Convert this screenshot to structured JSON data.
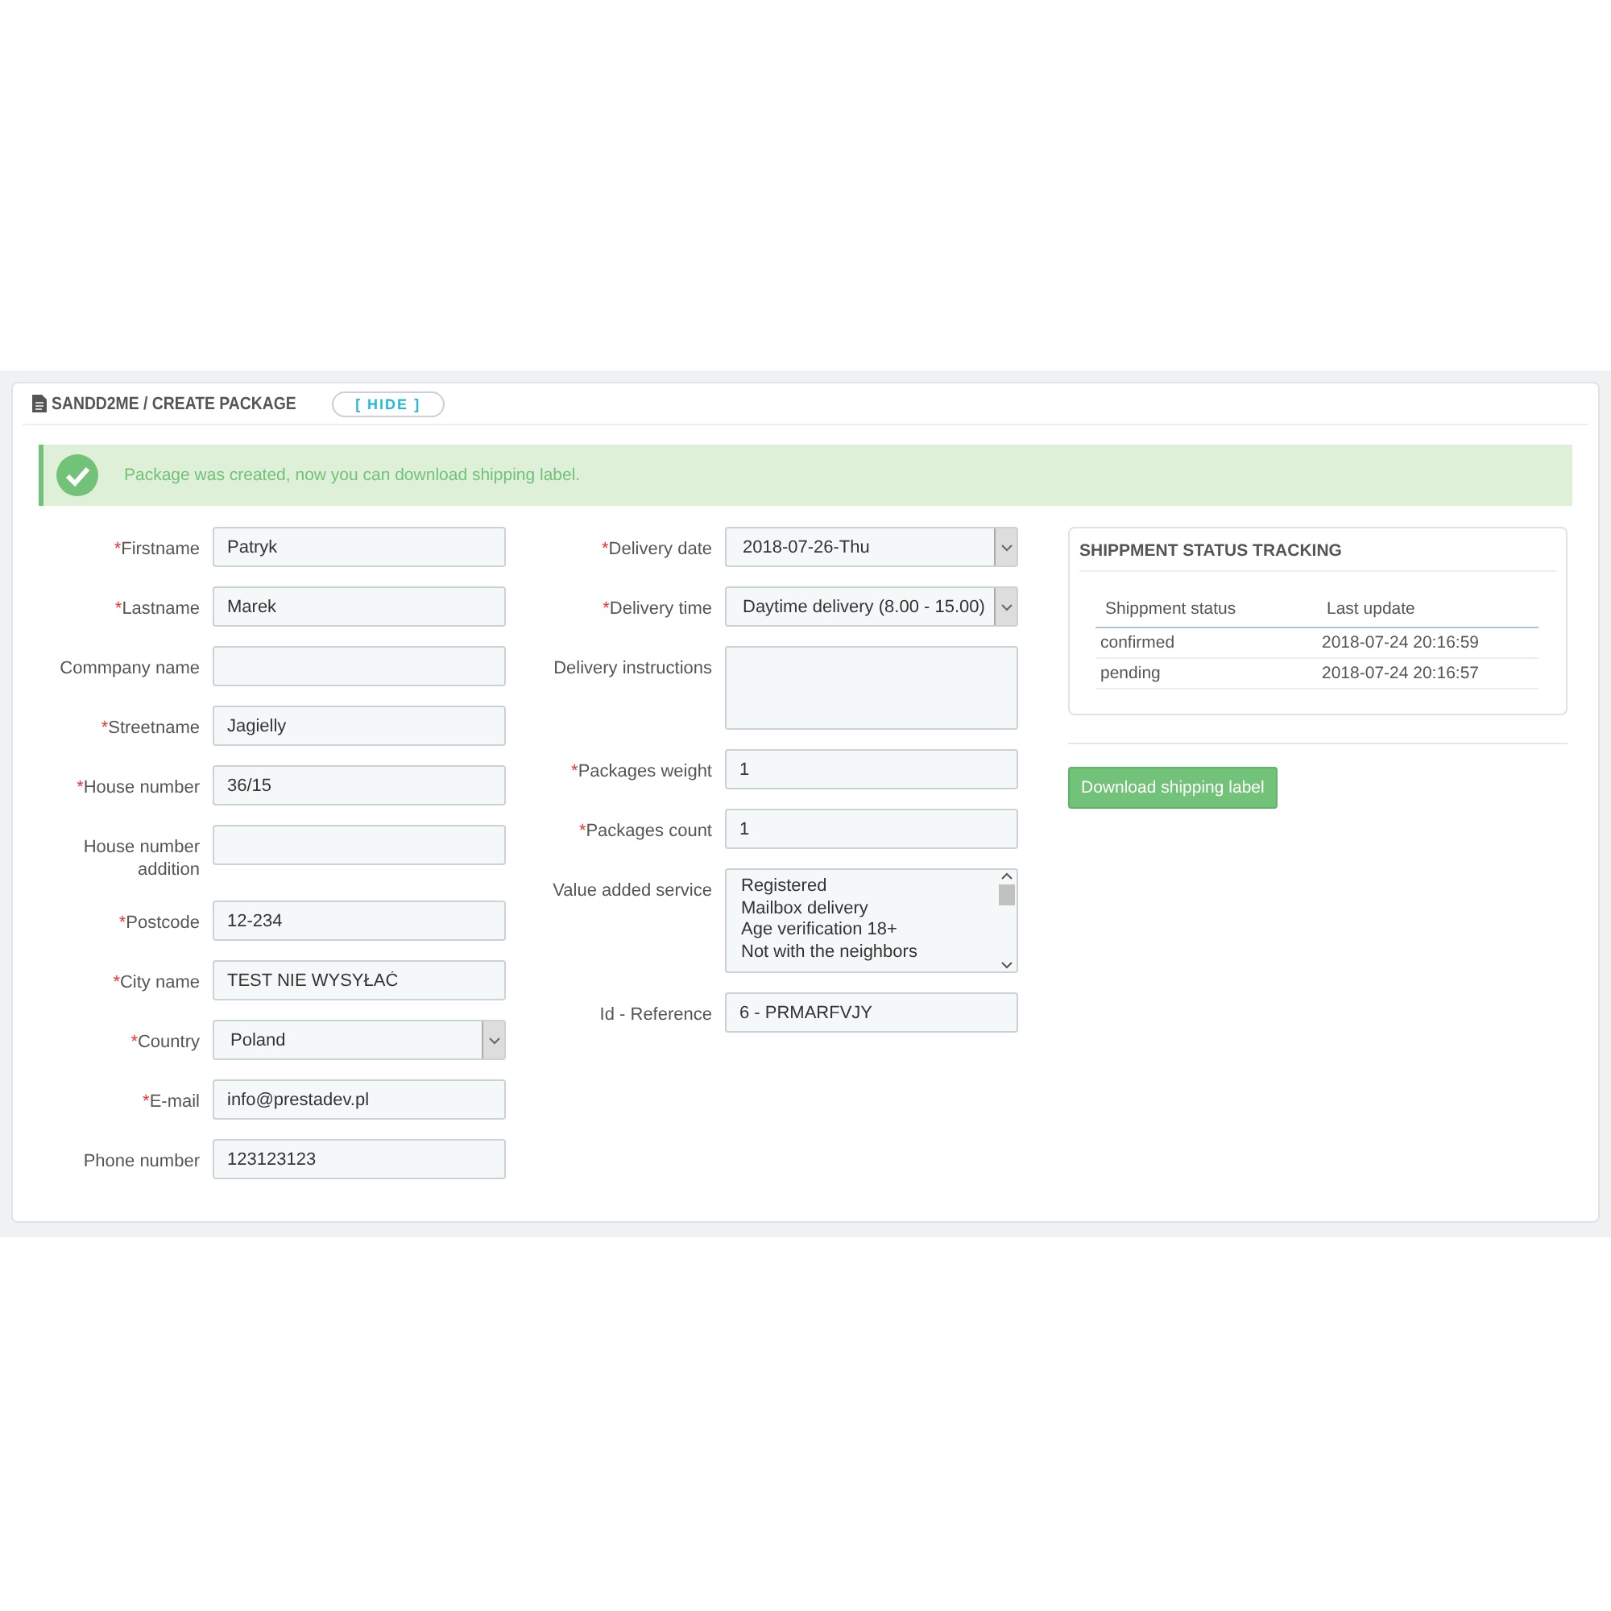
{
  "panel": {
    "title": "SANDD2ME / CREATE PACKAGE",
    "toggle": "[ HIDE ]"
  },
  "alert": {
    "kind": "success",
    "message": "Package was created, now you can download shipping label."
  },
  "left_fields": [
    {
      "label": "Firstname",
      "required": true,
      "kind": "text",
      "value": "Patryk"
    },
    {
      "label": "Lastname",
      "required": true,
      "kind": "text",
      "value": "Marek"
    },
    {
      "label": "Commpany name",
      "required": false,
      "kind": "text"
    },
    {
      "label": "Streetname",
      "required": true,
      "kind": "text",
      "value": "Jagielly"
    },
    {
      "label": "House number",
      "required": true,
      "kind": "text",
      "value": "36/15"
    },
    {
      "label": "House number addition",
      "required": false,
      "kind": "text"
    },
    {
      "label": "Postcode",
      "required": true,
      "kind": "text",
      "value": "12-234"
    },
    {
      "label": "City name",
      "required": true,
      "kind": "text",
      "value": "TEST NIE WYSYŁAĆ"
    },
    {
      "label": "Country",
      "required": true,
      "kind": "select",
      "value": "Poland"
    },
    {
      "label": "E-mail",
      "required": true,
      "kind": "text",
      "value": "info@prestadev.pl"
    },
    {
      "label": "Phone number",
      "required": false,
      "kind": "text",
      "value": "123123123"
    }
  ],
  "middle_fields": [
    {
      "label": "Delivery date",
      "required": true,
      "kind": "select",
      "value": "2018-07-26-Thu"
    },
    {
      "label": "Delivery time",
      "required": true,
      "kind": "select",
      "value": "Daytime delivery (8.00 - 15.00)"
    },
    {
      "label": "Delivery instructions",
      "required": false,
      "kind": "textarea"
    },
    {
      "label": "Packages weight",
      "required": true,
      "kind": "text",
      "value": "1"
    },
    {
      "label": "Packages count",
      "required": true,
      "kind": "text",
      "value": "1"
    },
    {
      "label": "Value added service",
      "required": false,
      "kind": "listbox",
      "options": [
        "Registered",
        "Mailbox delivery",
        "Age verification 18+",
        "Not with the neighbors"
      ]
    },
    {
      "label": "Id - Reference",
      "required": false,
      "kind": "text",
      "value": "6 - PRMARFVJY"
    }
  ],
  "tracking": {
    "title": "SHIPPMENT STATUS TRACKING",
    "columns": [
      "Shippment status",
      "Last update"
    ],
    "rows": [
      [
        "confirmed",
        "2018-07-24 20:16:59"
      ],
      [
        "pending",
        "2018-07-24 20:16:57"
      ]
    ]
  },
  "download_button": "Download shipping label",
  "required_mark": "*"
}
